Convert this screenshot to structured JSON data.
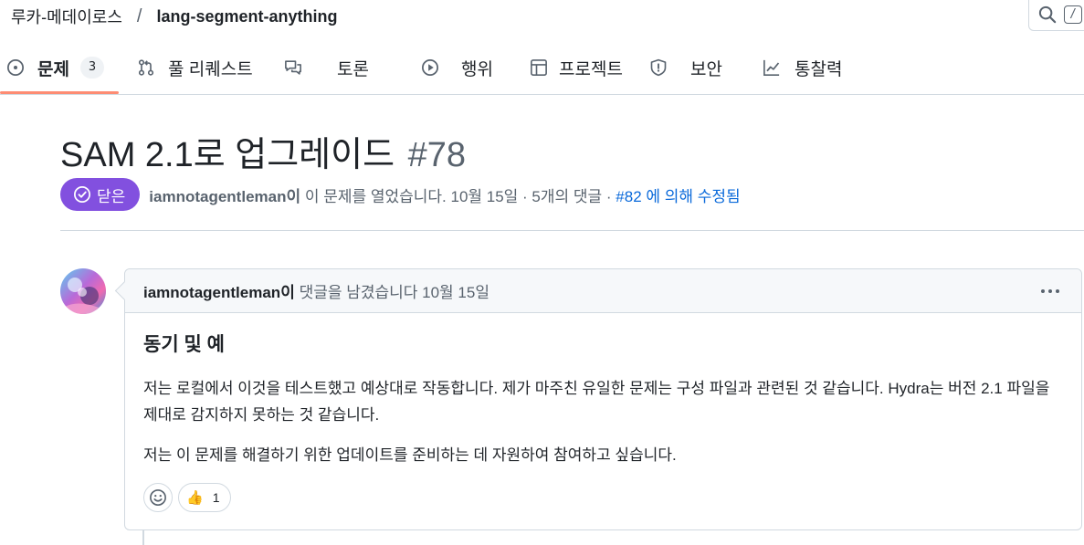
{
  "breadcrumb": {
    "owner": "루카-메데이로스",
    "separator": "/",
    "repo": "lang-segment-anything"
  },
  "search": {
    "shortcut": "/"
  },
  "tabs": [
    {
      "label": "문제",
      "count": "3",
      "icon": "issue-opened-icon",
      "active": true
    },
    {
      "label": "풀 리퀘스트",
      "icon": "git-pull-request-icon"
    },
    {
      "label": "토론",
      "icon": "comment-discussion-icon"
    },
    {
      "label": "행위",
      "icon": "play-icon"
    },
    {
      "label": "프로젝트",
      "icon": "table-icon"
    },
    {
      "label": "보안",
      "icon": "shield-icon"
    },
    {
      "label": "통찰력",
      "icon": "graph-icon"
    }
  ],
  "issue": {
    "title": "SAM 2.1로 업그레이드",
    "number": "#78",
    "state": "닫은",
    "state_color": "#8250df",
    "author": "iamnotagentleman이",
    "meta": " 이 문제를 열었습니다. 10월 15일 · 5개의 댓글 · ",
    "fixed_by_link": "#82",
    "fixed_by_text": " 에 의해 수정됨"
  },
  "comment": {
    "author": "iamnotagentleman이",
    "action": " 댓글을 남겼습니다 10월 15일",
    "heading": "동기 및 예",
    "paragraphs": [
      "저는 로컬에서 이것을 테스트했고 예상대로 작동합니다. 제가 마주친 유일한 문제는 구성 파일과 관련된 것 같습니다. Hydra는 버전 2.1 파일을 제대로 감지하지 못하는 것 같습니다.",
      "저는 이 문제를 해결하기 위한 업데이트를 준비하는 데 자원하여 참여하고 싶습니다."
    ],
    "reactions": {
      "thumbs_up_count": "1"
    }
  },
  "colors": {
    "accent_underline": "#fd8c73",
    "link": "#0969da",
    "closed": "#8250df"
  }
}
